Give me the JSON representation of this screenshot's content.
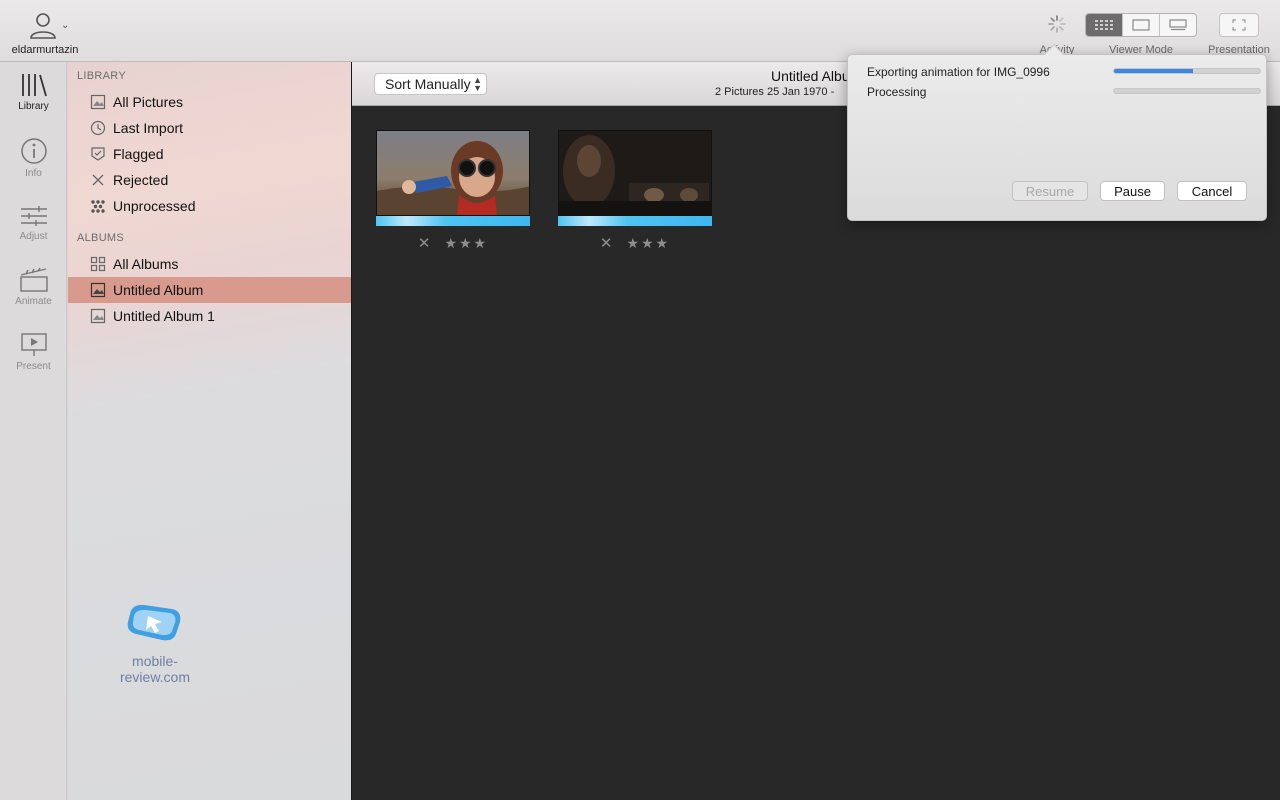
{
  "toolbar": {
    "user_name": "eldarmurtazin",
    "activity_label": "Activity",
    "viewer_mode_label": "Viewer Mode",
    "presentation_label": "Presentation"
  },
  "rail": [
    {
      "label": "Library",
      "icon": "library-icon"
    },
    {
      "label": "Info",
      "icon": "info-icon"
    },
    {
      "label": "Adjust",
      "icon": "sliders-icon"
    },
    {
      "label": "Animate",
      "icon": "clapperboard-icon"
    },
    {
      "label": "Present",
      "icon": "presentation-icon"
    }
  ],
  "sidebar": {
    "library_heading": "LIBRARY",
    "library_items": [
      {
        "label": "All Pictures",
        "icon": "photo-icon"
      },
      {
        "label": "Last Import",
        "icon": "clock-icon"
      },
      {
        "label": "Flagged",
        "icon": "flag-icon"
      },
      {
        "label": "Rejected",
        "icon": "x-icon"
      },
      {
        "label": "Unprocessed",
        "icon": "dots-icon"
      }
    ],
    "albums_heading": "ALBUMS",
    "album_items": [
      {
        "label": "All Albums",
        "icon": "grid-icon"
      },
      {
        "label": "Untitled Album",
        "icon": "album-icon",
        "selected": true
      },
      {
        "label": "Untitled Album 1",
        "icon": "album-icon"
      }
    ]
  },
  "watermark": "mobile-review.com",
  "content": {
    "sort_label": "Sort Manually",
    "album_title": "Untitled Album",
    "album_subtitle": "2 Pictures  25 Jan 1970 -",
    "thumbnails": [
      {
        "stars": "★★★",
        "reject": "✕"
      },
      {
        "stars": "★★★",
        "reject": "✕"
      }
    ]
  },
  "activity_popover": {
    "tasks": [
      {
        "label": "Exporting animation for IMG_0996",
        "progress": 0.54
      },
      {
        "label": "Processing",
        "progress": 0
      }
    ],
    "resume_label": "Resume",
    "pause_label": "Pause",
    "cancel_label": "Cancel"
  },
  "colors": {
    "selection": "#d99a8e",
    "progress": "#3b87e6",
    "thumb_bar": "#4fc4f2"
  }
}
